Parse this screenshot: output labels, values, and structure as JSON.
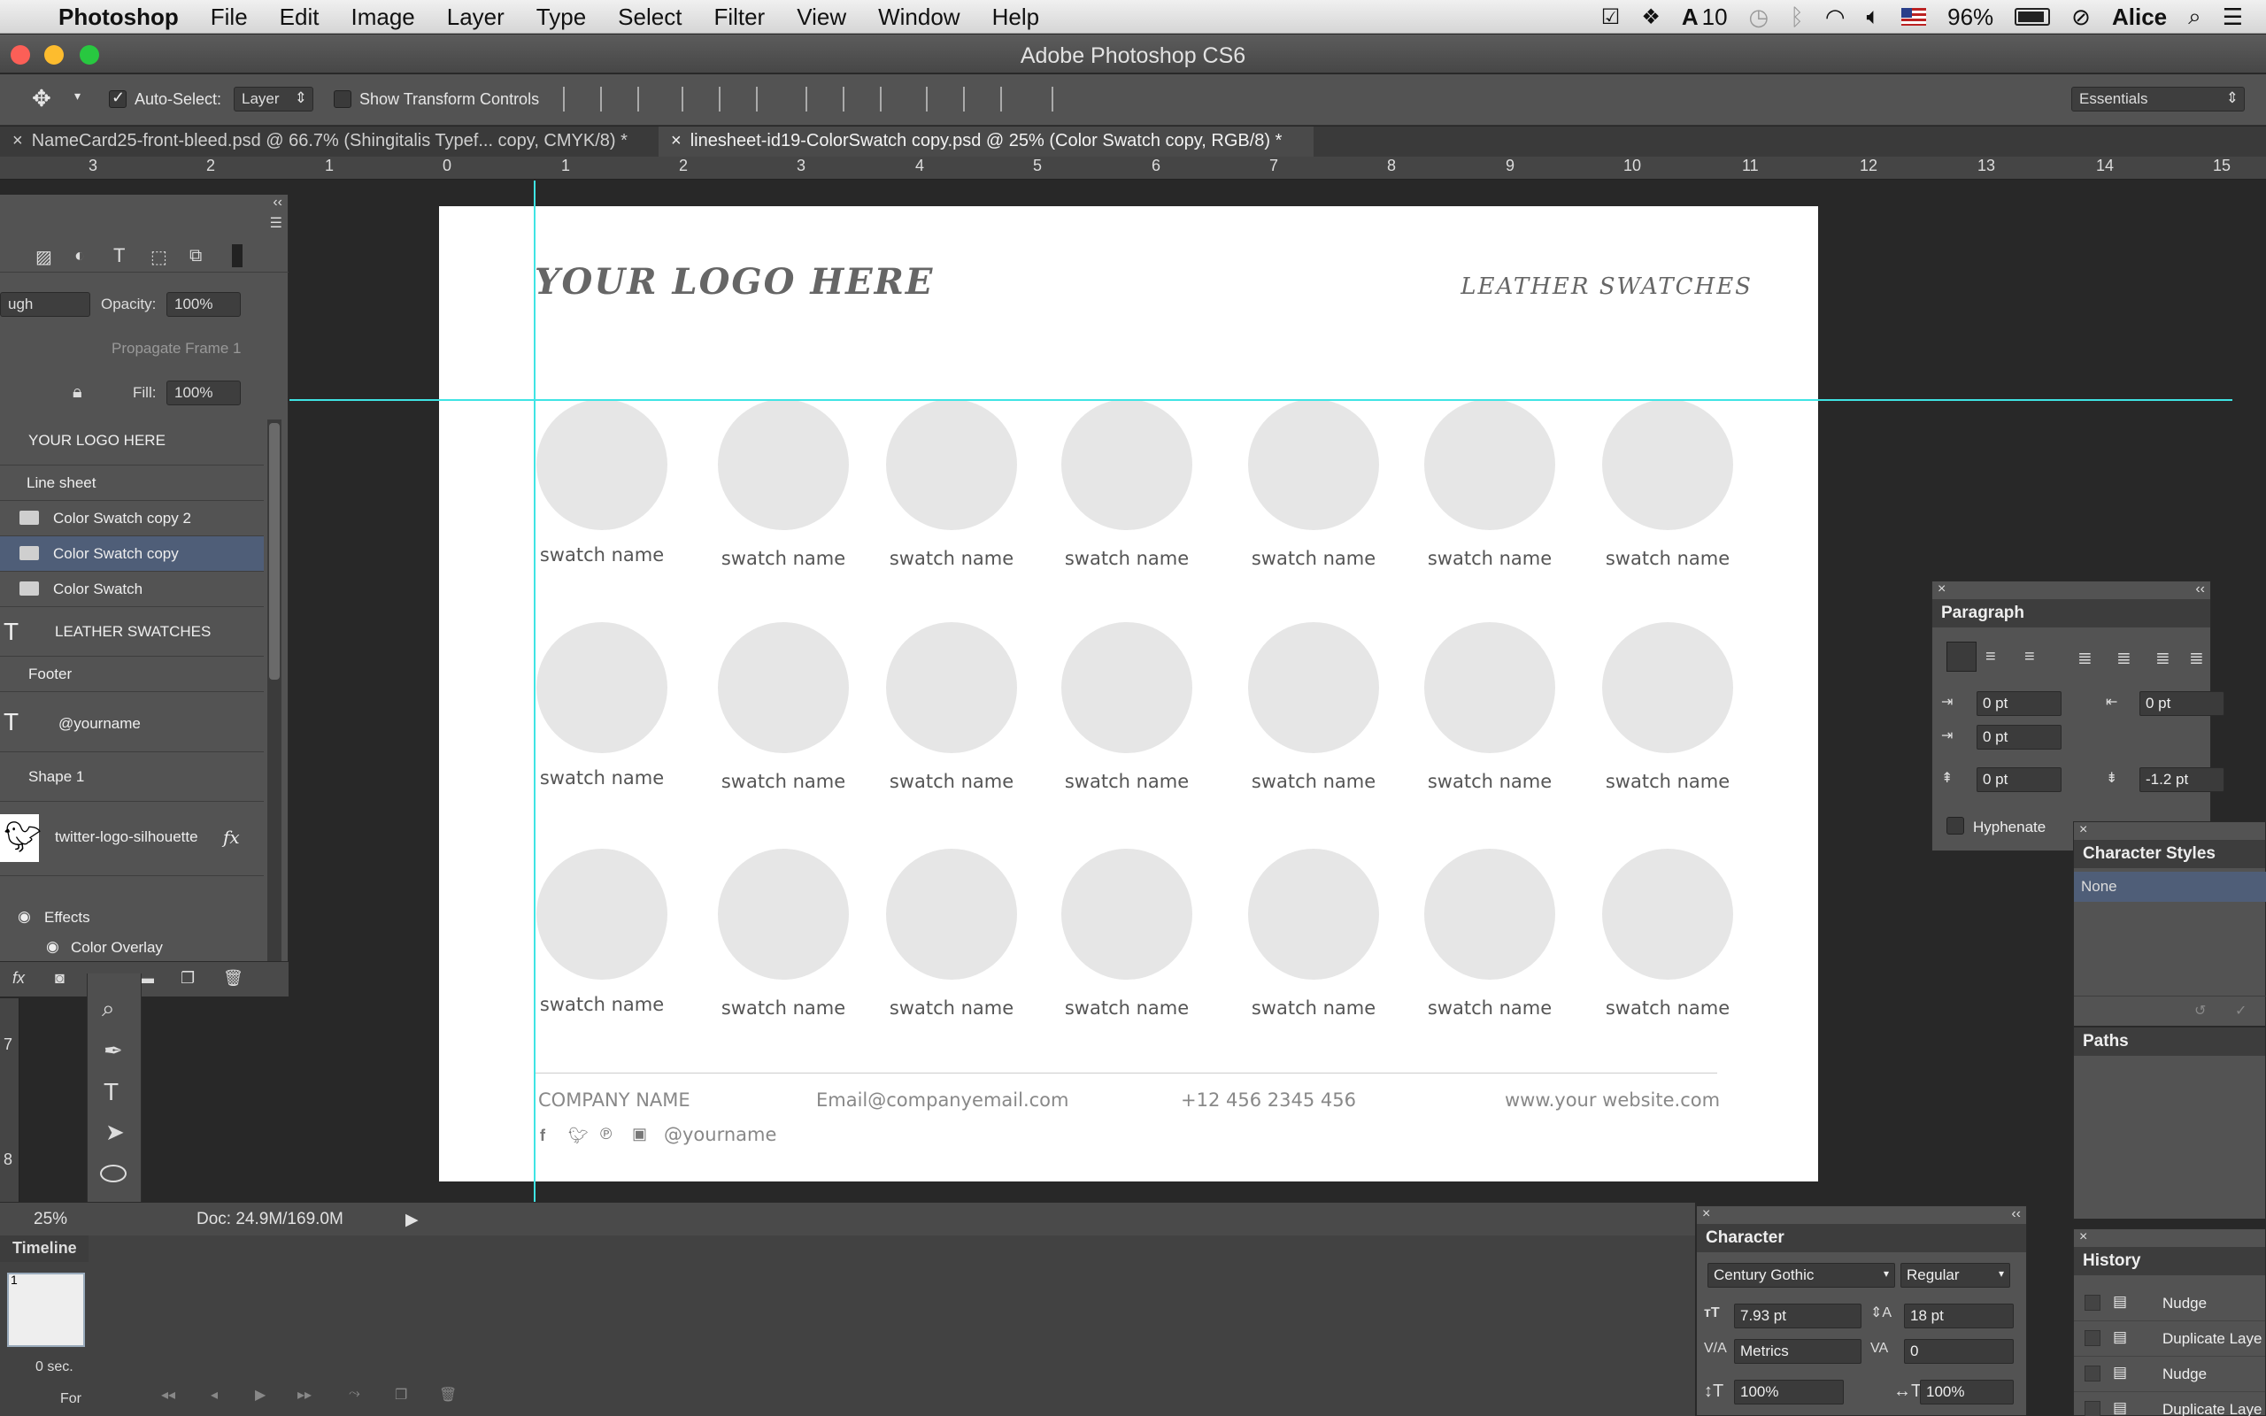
{
  "menubar": {
    "app_name": "Photoshop",
    "menus": [
      "File",
      "Edit",
      "Image",
      "Layer",
      "Type",
      "Select",
      "Filter",
      "View",
      "Window",
      "Help"
    ],
    "adobe_count": "10",
    "battery": "96%",
    "user": "Alice"
  },
  "window": {
    "title": "Adobe Photoshop CS6"
  },
  "options": {
    "auto_select_label": "Auto-Select:",
    "auto_select_value": "Layer",
    "show_transform_label": "Show Transform Controls",
    "workspace": "Essentials"
  },
  "tabs": [
    {
      "label": "NameCard25-front-bleed.psd @ 66.7% (Shingitalis Typef... copy, CMYK/8) *"
    },
    {
      "label": "linesheet-id19-ColorSwatch copy.psd @ 25% (Color Swatch copy, RGB/8) *"
    }
  ],
  "ruler": {
    "numbers": [
      "3",
      "2",
      "1",
      "0",
      "1",
      "2",
      "3",
      "4",
      "5",
      "6",
      "7",
      "8",
      "9",
      "10",
      "11",
      "12",
      "13",
      "14",
      "15"
    ]
  },
  "layers_panel": {
    "blend_value": "ugh",
    "opacity_label": "Opacity:",
    "opacity_value": "100%",
    "propagate_label": "Propagate Frame 1",
    "fill_label": "Fill:",
    "fill_value": "100%",
    "items": [
      {
        "label": "YOUR LOGO HERE"
      },
      {
        "label": "Line sheet"
      },
      {
        "label": "Color Swatch copy 2"
      },
      {
        "label": "Color Swatch copy"
      },
      {
        "label": "Color Swatch"
      },
      {
        "label": "LEATHER SWATCHES"
      },
      {
        "label": "Footer"
      },
      {
        "label": "@yourname"
      },
      {
        "label": "Shape 1"
      },
      {
        "label": "twitter-logo-silhouette"
      },
      {
        "label": "Effects"
      },
      {
        "label": "Color Overlay"
      }
    ],
    "fx_label": "fx"
  },
  "document": {
    "logo_text": "YOUR LOGO HERE",
    "heading": "LEATHER SWATCHES",
    "swatch_label": "swatch name",
    "footer": {
      "company": "COMPANY NAME",
      "email": "Email@companyemail.com",
      "phone": "+12 456 2345 456",
      "website": "www.your website.com",
      "handle": "@yourname"
    }
  },
  "vertical_ruler": {
    "n7": "7",
    "n8": "8"
  },
  "status": {
    "zoom": "25%",
    "doc": "Doc: 24.9M/169.0M"
  },
  "timeline": {
    "title": "Timeline",
    "frame_number": "1",
    "frame_delay": "0 sec.",
    "forever_label": "For"
  },
  "paragraph_panel": {
    "title": "Paragraph",
    "indent_left": "0 pt",
    "indent_right": "0 pt",
    "first_line": "0 pt",
    "space_before": "0 pt",
    "space_after": "-1.2 pt",
    "hyphenate_label": "Hyphenate"
  },
  "character_styles_panel": {
    "title": "Character Styles",
    "selected": "None"
  },
  "paths_panel": {
    "title": "Paths"
  },
  "character_panel": {
    "title": "Character",
    "font_family": "Century Gothic",
    "font_style": "Regular",
    "size": "7.93 pt",
    "leading": "18 pt",
    "kerning": "Metrics",
    "tracking": "0",
    "vscale": "100%",
    "hscale": "100%"
  },
  "history_panel": {
    "title": "History",
    "items": [
      {
        "label": "Nudge"
      },
      {
        "label": "Duplicate Laye"
      },
      {
        "label": "Nudge"
      },
      {
        "label": "Duplicate Laye"
      }
    ]
  }
}
